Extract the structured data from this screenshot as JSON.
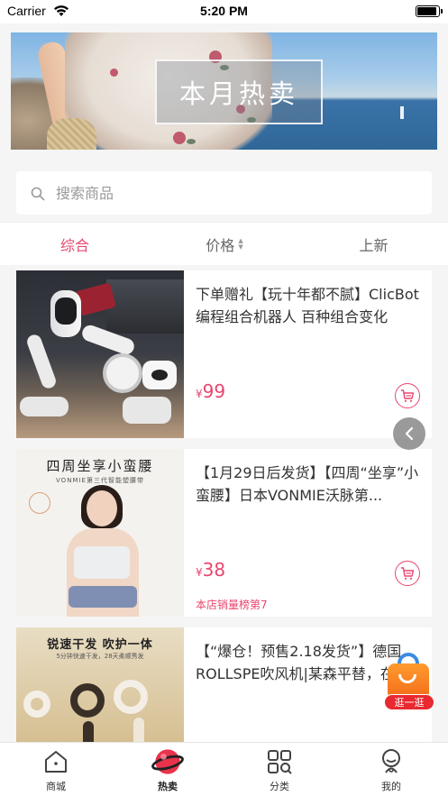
{
  "status_bar": {
    "carrier": "Carrier",
    "time": "5:20 PM"
  },
  "banner": {
    "title": "本月热卖"
  },
  "search": {
    "placeholder": "搜索商品"
  },
  "sort_tabs": [
    {
      "label": "综合",
      "active": true
    },
    {
      "label": "价格",
      "active": false
    },
    {
      "label": "上新",
      "active": false
    }
  ],
  "products": [
    {
      "title": "下单赠礼【玩十年都不腻】ClicBot编程组合机器人 百种组合变化",
      "price_symbol": "¥",
      "price": "99"
    },
    {
      "title": "【1月29日后发货】【四周“坐享”小蛮腰】日本VONMIE沃脉第...",
      "price_symbol": "¥",
      "price": "38",
      "sales_rank": "本店销量榜第7",
      "image_text": {
        "title": "四周坐享小蛮腰",
        "subtitle": "VONMIE第三代智能塑腰带"
      }
    },
    {
      "title": "【“爆仓！预售2.18发货”】德国ROLLSPE吹风机|某森平替，在...",
      "image_text": {
        "title": "锐速干发  吹护一体",
        "subtitle": "5分钟快速干发，28天柔顺秀发"
      }
    }
  ],
  "floating": {
    "bag_label": "逛一逛"
  },
  "tab_bar": [
    {
      "label": "商城",
      "icon": "home-icon",
      "active": false
    },
    {
      "label": "热卖",
      "icon": "planet-icon",
      "active": true
    },
    {
      "label": "分类",
      "icon": "category-grid-icon",
      "active": false
    },
    {
      "label": "我的",
      "icon": "profile-icon",
      "active": false
    }
  ],
  "colors": {
    "accent": "#e8466d",
    "background": "#f5f5f5"
  }
}
